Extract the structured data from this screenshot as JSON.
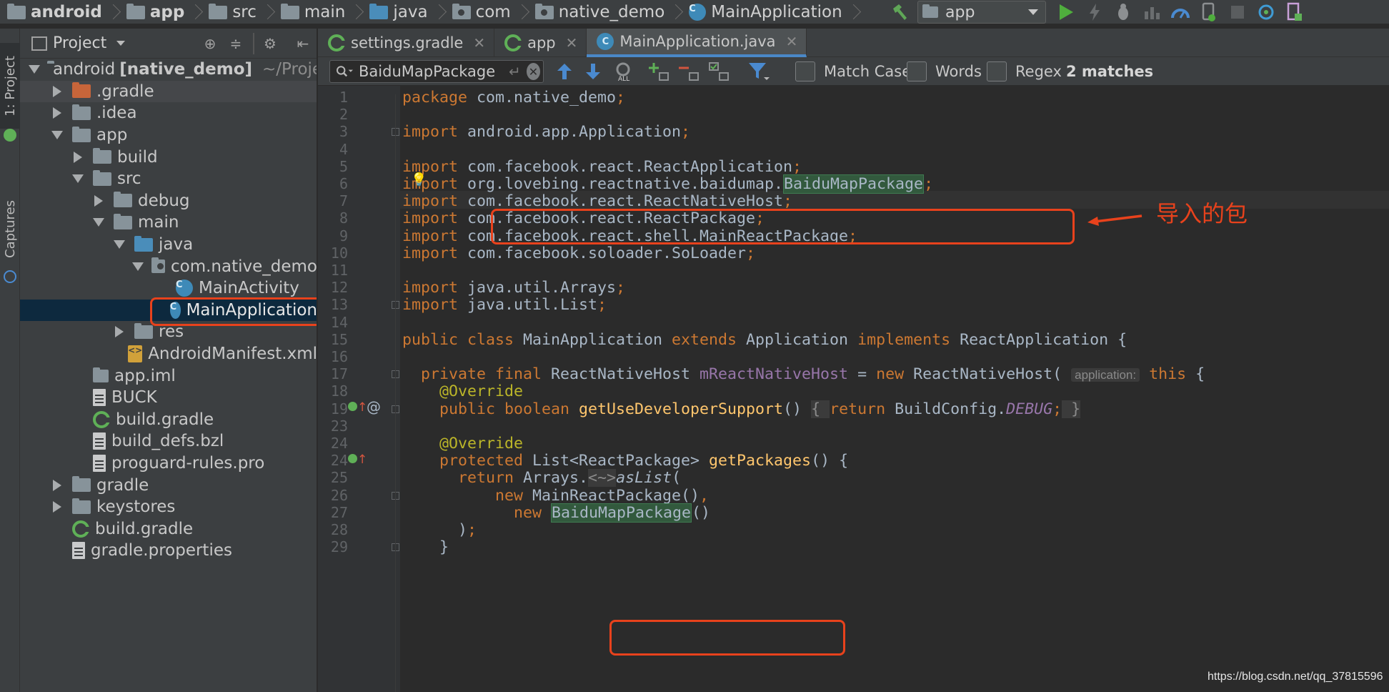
{
  "breadcrumbs": [
    {
      "label": "android",
      "bold": true,
      "icon": "project-folder-icon"
    },
    {
      "label": "app",
      "bold": true,
      "icon": "module-folder-icon"
    },
    {
      "label": "src",
      "icon": "folder-icon"
    },
    {
      "label": "main",
      "icon": "folder-icon"
    },
    {
      "label": "java",
      "icon": "source-folder-icon"
    },
    {
      "label": "com",
      "icon": "package-folder-icon"
    },
    {
      "label": "native_demo",
      "icon": "package-folder-icon"
    },
    {
      "label": "MainApplication",
      "icon": "class-icon"
    }
  ],
  "toolbar": {
    "run_config": "app",
    "icons": [
      "hammer-icon",
      "run-icon",
      "lightning-icon",
      "debug-icon",
      "attach-icon",
      "profiler-icon",
      "device-icon",
      "stop-icon",
      "sync-icon",
      "sdk-icon"
    ]
  },
  "tool_strip": {
    "project_tab": "1: Project",
    "captures_tab": "Captures"
  },
  "project_panel": {
    "title": "Project",
    "tree": [
      {
        "label": "android",
        "suffix": "[native_demo]",
        "extra": "~/Project/n",
        "depth": 0,
        "state": "open",
        "icon": "project-folder-icon"
      },
      {
        "label": ".gradle",
        "depth": 1,
        "state": "closed",
        "icon": "orange-folder-icon",
        "highlight": true
      },
      {
        "label": ".idea",
        "depth": 1,
        "state": "closed",
        "icon": "folder-icon"
      },
      {
        "label": "app",
        "depth": 1,
        "state": "open",
        "icon": "module-folder-icon"
      },
      {
        "label": "build",
        "depth": 2,
        "state": "closed",
        "icon": "folder-icon"
      },
      {
        "label": "src",
        "depth": 2,
        "state": "open",
        "icon": "folder-icon"
      },
      {
        "label": "debug",
        "depth": 3,
        "state": "closed",
        "icon": "folder-icon"
      },
      {
        "label": "main",
        "depth": 3,
        "state": "open",
        "icon": "folder-icon"
      },
      {
        "label": "java",
        "depth": 4,
        "state": "open",
        "icon": "source-folder-icon"
      },
      {
        "label": "com.native_demo",
        "depth": 5,
        "state": "open",
        "icon": "package-folder-icon"
      },
      {
        "label": "MainActivity",
        "depth": 6,
        "state": "none",
        "icon": "class-icon"
      },
      {
        "label": "MainApplication",
        "depth": 6,
        "state": "none",
        "icon": "class-icon",
        "selected": true
      },
      {
        "label": "res",
        "depth": 4,
        "state": "closed",
        "icon": "resource-folder-icon"
      },
      {
        "label": "AndroidManifest.xml",
        "depth": 4,
        "state": "none",
        "icon": "xml-file-icon"
      },
      {
        "label": "app.iml",
        "depth": 2,
        "state": "none",
        "icon": "module-file-icon"
      },
      {
        "label": "BUCK",
        "depth": 2,
        "state": "none",
        "icon": "text-file-icon"
      },
      {
        "label": "build.gradle",
        "depth": 2,
        "state": "none",
        "icon": "gradle-file-icon"
      },
      {
        "label": "build_defs.bzl",
        "depth": 2,
        "state": "none",
        "icon": "text-file-icon"
      },
      {
        "label": "proguard-rules.pro",
        "depth": 2,
        "state": "none",
        "icon": "text-file-icon"
      },
      {
        "label": "gradle",
        "depth": 1,
        "state": "closed",
        "icon": "folder-icon"
      },
      {
        "label": "keystores",
        "depth": 1,
        "state": "closed",
        "icon": "folder-icon"
      },
      {
        "label": "build.gradle",
        "depth": 1,
        "state": "none",
        "icon": "gradle-file-icon"
      },
      {
        "label": "gradle.properties",
        "depth": 1,
        "state": "none",
        "icon": "properties-file-icon"
      }
    ]
  },
  "tabs": [
    {
      "label": "settings.gradle",
      "icon": "gradle-file-icon"
    },
    {
      "label": "app",
      "icon": "gradle-file-icon"
    },
    {
      "label": "MainApplication.java",
      "icon": "class-icon",
      "active": true
    }
  ],
  "search": {
    "query": "BaiduMapPackage",
    "match_case_label": "Match Case",
    "words_label": "Words",
    "regex_label": "Regex",
    "matches_label": "2 matches"
  },
  "editor": {
    "lines": [
      {
        "n": "1",
        "segs": [
          [
            "kw",
            "package "
          ],
          [
            "",
            "com.native_demo"
          ],
          [
            "kw",
            ";"
          ]
        ]
      },
      {
        "n": "2",
        "segs": []
      },
      {
        "n": "3",
        "segs": [
          [
            "kw",
            "import "
          ],
          [
            "",
            "android.app.Application"
          ],
          [
            "kw",
            ";"
          ]
        ]
      },
      {
        "n": "4",
        "segs": []
      },
      {
        "n": "5",
        "segs": [
          [
            "kw",
            "import "
          ],
          [
            "",
            "com.facebook.react.ReactApplication"
          ],
          [
            "kw",
            ";"
          ]
        ]
      },
      {
        "n": "6",
        "segs": [
          [
            "kw",
            "import "
          ],
          [
            "",
            "org.lovebing.reactnative.baidumap."
          ],
          [
            "hl",
            "BaiduMapPackage"
          ],
          [
            "kw",
            ";"
          ]
        ]
      },
      {
        "n": "7",
        "segs": [
          [
            "kw",
            "import "
          ],
          [
            "",
            "com.facebook.react.ReactNativeHost"
          ],
          [
            "kw",
            ";"
          ]
        ]
      },
      {
        "n": "8",
        "segs": [
          [
            "kw",
            "import "
          ],
          [
            "",
            "com.facebook.react.ReactPackage"
          ],
          [
            "kw",
            ";"
          ]
        ]
      },
      {
        "n": "9",
        "segs": [
          [
            "kw",
            "import "
          ],
          [
            "",
            "com.facebook.react.shell.MainReactPackage"
          ],
          [
            "kw",
            ";"
          ]
        ]
      },
      {
        "n": "10",
        "segs": [
          [
            "kw",
            "import "
          ],
          [
            "",
            "com.facebook.soloader.SoLoader"
          ],
          [
            "kw",
            ";"
          ]
        ]
      },
      {
        "n": "11",
        "segs": []
      },
      {
        "n": "12",
        "segs": [
          [
            "kw",
            "import "
          ],
          [
            "",
            "java.util.Arrays"
          ],
          [
            "kw",
            ";"
          ]
        ]
      },
      {
        "n": "13",
        "segs": [
          [
            "kw",
            "import "
          ],
          [
            "",
            "java.util.List"
          ],
          [
            "kw",
            ";"
          ]
        ]
      },
      {
        "n": "14",
        "segs": []
      },
      {
        "n": "15",
        "segs": [
          [
            "kw",
            "public class "
          ],
          [
            "",
            "MainApplication "
          ],
          [
            "kw",
            "extends "
          ],
          [
            "",
            "Application "
          ],
          [
            "kw",
            "implements "
          ],
          [
            "",
            "ReactApplication {"
          ]
        ]
      },
      {
        "n": "16",
        "segs": []
      },
      {
        "n": "17",
        "segs": [
          [
            "",
            "  "
          ],
          [
            "kw",
            "private final "
          ],
          [
            "",
            "ReactNativeHost "
          ],
          [
            "fld",
            "mReactNativeHost "
          ],
          [
            "",
            "= "
          ],
          [
            "kw",
            "new "
          ],
          [
            "",
            "ReactNativeHost( "
          ],
          [
            "hint",
            "application:"
          ],
          [
            "kw",
            " this"
          ],
          [
            "",
            " {"
          ]
        ]
      },
      {
        "n": "18",
        "segs": [
          [
            "",
            "    "
          ],
          [
            "an",
            "@Override"
          ]
        ]
      },
      {
        "n": "19",
        "segs": [
          [
            "",
            "    "
          ],
          [
            "kw",
            "public boolean "
          ],
          [
            "fn",
            "getUseDeveloperSupport"
          ],
          [
            "",
            "() "
          ],
          [
            "fold",
            "{ "
          ],
          [
            "kw",
            "return "
          ],
          [
            "",
            "BuildConfig."
          ],
          [
            "fldit",
            "DEBUG"
          ],
          [
            "kw",
            ";"
          ],
          [
            "fold",
            " }"
          ]
        ]
      },
      {
        "n": "23",
        "segs": []
      },
      {
        "n": "24",
        "segs": [
          [
            "",
            "    "
          ],
          [
            "an",
            "@Override"
          ]
        ]
      },
      {
        "n": "24",
        "segs": [
          [
            "",
            "    "
          ],
          [
            "kw",
            "protected "
          ],
          [
            "",
            "List<ReactPackage> "
          ],
          [
            "fn",
            "getPackages"
          ],
          [
            "",
            "() {"
          ]
        ]
      },
      {
        "n": "25",
        "segs": [
          [
            "",
            "      "
          ],
          [
            "kw",
            "return "
          ],
          [
            "",
            "Arrays."
          ],
          [
            "fold",
            "<~>"
          ],
          [
            "it",
            "asList"
          ],
          [
            "",
            "("
          ]
        ]
      },
      {
        "n": "26",
        "segs": [
          [
            "",
            "          "
          ],
          [
            "kw",
            "new "
          ],
          [
            "",
            "MainReactPackage()"
          ],
          [
            "kw",
            ","
          ]
        ]
      },
      {
        "n": "27",
        "segs": [
          [
            "",
            "            "
          ],
          [
            "kw",
            "new "
          ],
          [
            "hl",
            "BaiduMapPackage"
          ],
          [
            "",
            "()"
          ]
        ]
      },
      {
        "n": "28",
        "segs": [
          [
            "",
            "      )"
          ],
          [
            "kw",
            ";"
          ]
        ]
      },
      {
        "n": "29",
        "segs": [
          [
            "",
            "    }"
          ]
        ]
      }
    ]
  },
  "annotation": {
    "text": "导入的包"
  },
  "watermark": "https://blog.csdn.net/qq_37815596"
}
